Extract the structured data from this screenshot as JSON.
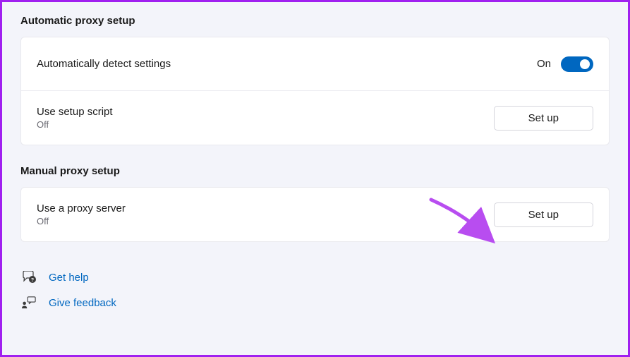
{
  "sections": {
    "automatic": {
      "heading": "Automatic proxy setup",
      "auto_detect": {
        "title": "Automatically detect settings",
        "state_label": "On"
      },
      "setup_script": {
        "title": "Use setup script",
        "sub": "Off",
        "button_label": "Set up"
      }
    },
    "manual": {
      "heading": "Manual proxy setup",
      "proxy_server": {
        "title": "Use a proxy server",
        "sub": "Off",
        "button_label": "Set up"
      }
    }
  },
  "footer": {
    "get_help": "Get help",
    "give_feedback": "Give feedback"
  }
}
